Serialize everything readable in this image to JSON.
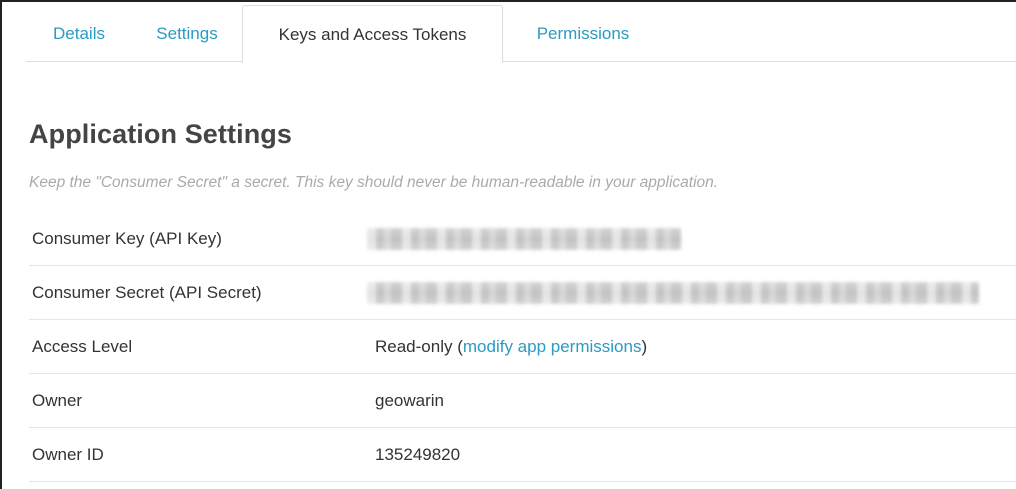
{
  "tabs": [
    {
      "label": "Details",
      "active": false
    },
    {
      "label": "Settings",
      "active": false
    },
    {
      "label": "Keys and Access Tokens",
      "active": true
    },
    {
      "label": "Permissions",
      "active": false
    }
  ],
  "page": {
    "title": "Application Settings",
    "note": "Keep the \"Consumer Secret\" a secret. This key should never be human-readable in your application."
  },
  "rows": {
    "consumer_key": {
      "label": "Consumer Key (API Key)",
      "value_state": "redacted"
    },
    "consumer_secret": {
      "label": "Consumer Secret (API Secret)",
      "value_state": "redacted"
    },
    "access_level": {
      "label": "Access Level",
      "value": "Read-only",
      "paren_open": " (",
      "link": "modify app permissions",
      "paren_close": ")"
    },
    "owner": {
      "label": "Owner",
      "value": "geowarin"
    },
    "owner_id": {
      "label": "Owner ID",
      "value": "135249820"
    }
  },
  "colors": {
    "link": "#2b9bc1",
    "text": "#333333",
    "muted": "#aaaaaa",
    "border": "#dddddd"
  }
}
